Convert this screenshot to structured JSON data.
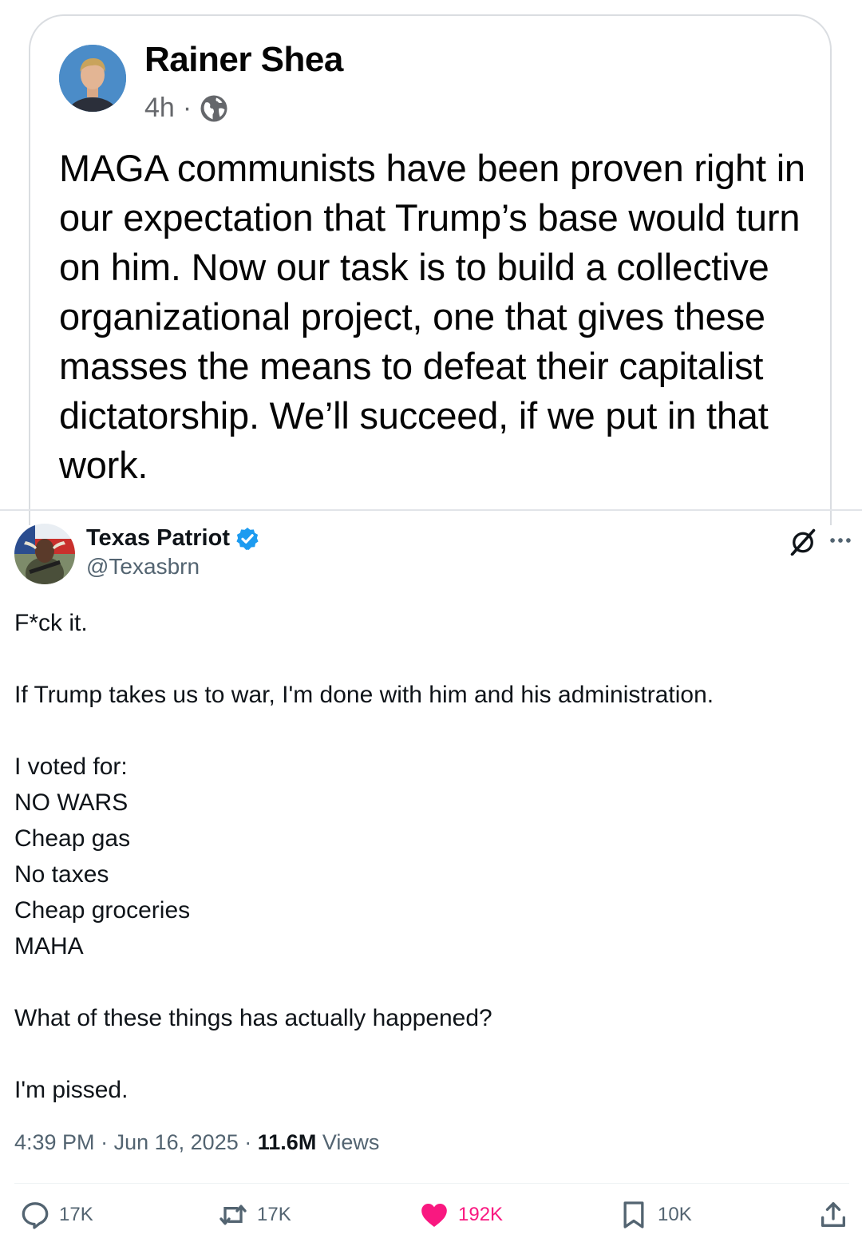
{
  "fb_post": {
    "author": "Rainer Shea",
    "time": "4h",
    "separator": "·",
    "visibility_icon": "globe-icon",
    "text": "MAGA communists have been proven right in our expectation that Trump’s base would turn on him. Now our task is to build a collective organizational project, one that gives these masses the means to defeat their capitalist dictatorship. We’ll succeed, if we put in that work."
  },
  "tweet": {
    "display_name": "Texas Patriot",
    "handle": "@Texasbrn",
    "verified": true,
    "lines": [
      "F*ck it.",
      "",
      "If Trump takes us to war, I'm done with him and his administration.",
      "",
      "I voted for:",
      "NO WARS",
      "Cheap gas",
      "No taxes",
      "Cheap groceries",
      "MAHA",
      "",
      "What of these things has actually happened?",
      "",
      "I'm pissed."
    ],
    "time": "4:39 PM",
    "date": "Jun 16, 2025",
    "meta_separator": "·",
    "views_count": "11.6M",
    "views_label": "Views",
    "actions": {
      "replies": "17K",
      "reposts": "17K",
      "likes": "192K",
      "bookmarks": "10K"
    },
    "colors": {
      "accent": "#1d9bf0",
      "like": "#f91880",
      "secondary_text": "#536471"
    }
  }
}
